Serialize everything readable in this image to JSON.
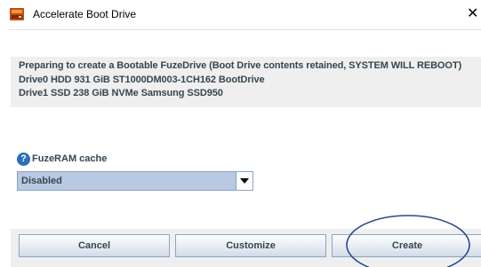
{
  "window": {
    "title": "Accelerate Boot Drive",
    "close_symbol": "✕"
  },
  "info": {
    "lines": [
      "Preparing to create a Bootable FuzeDrive (Boot Drive contents retained, SYSTEM WILL REBOOT)",
      "Drive0   HDD  931 GiB  ST1000DM003-1CH162 BootDrive",
      "Drive1   SSD  238 GiB  NVMe Samsung SSD950"
    ]
  },
  "fuzeram": {
    "help_glyph": "?",
    "label": "FuzeRAM cache",
    "selected": "Disabled"
  },
  "buttons": {
    "cancel": "Cancel",
    "customize": "Customize",
    "create": "Create"
  },
  "colors": {
    "accent": "#2d6fb8",
    "select_bg": "#b8c9e3",
    "annotation_ring": "#2a4a8c"
  },
  "icons": {
    "app": "fuzedrive-app-icon",
    "help": "help-icon",
    "dropdown": "chevron-down-icon",
    "close": "close-icon"
  }
}
